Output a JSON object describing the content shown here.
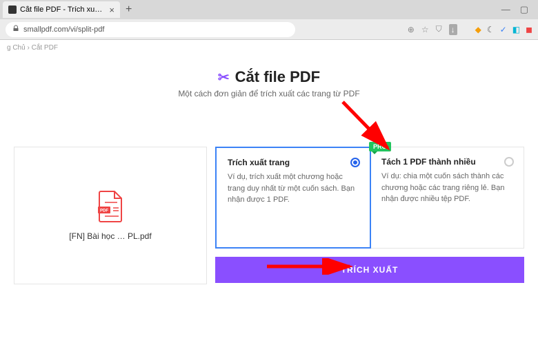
{
  "browser": {
    "tab_title": "Cắt file PDF - Trích xuất trang",
    "url": "smallpdf.com/vi/split-pdf",
    "window_min": "—",
    "window_max": "▢"
  },
  "breadcrumb": {
    "home": "g Chủ",
    "sep": "›",
    "current": "Cắt PDF"
  },
  "header": {
    "title": "Cắt file PDF",
    "subtitle": "Một cách đơn giản để trích xuất các trang từ PDF"
  },
  "file": {
    "name": "[FN] Bài học … PL.pdf",
    "badge": "PDF"
  },
  "options": {
    "extract": {
      "title": "Trích xuất trang",
      "desc": "Ví dụ, trích xuất một chương hoặc trang duy nhất từ một cuốn sách. Bạn nhận được 1 PDF."
    },
    "split": {
      "pro": "PRO",
      "title": "Tách 1 PDF thành nhiều",
      "desc": "Ví dụ: chia một cuốn sách thành các chương hoặc các trang riêng lẻ. Bạn nhận được nhiều tệp PDF."
    }
  },
  "button": {
    "extract": "TRÍCH XUẤT"
  }
}
